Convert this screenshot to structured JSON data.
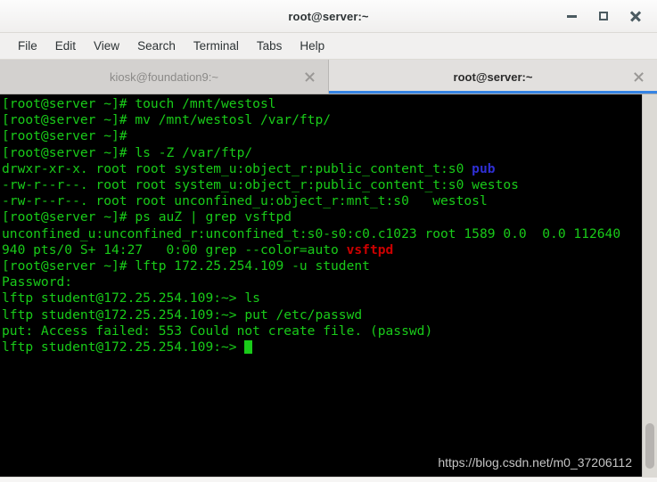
{
  "window": {
    "title": "root@server:~",
    "controls": {
      "minimize": "minimize",
      "maximize": "maximize",
      "close": "close"
    }
  },
  "menubar": {
    "items": [
      {
        "label": "File"
      },
      {
        "label": "Edit"
      },
      {
        "label": "View"
      },
      {
        "label": "Search"
      },
      {
        "label": "Terminal"
      },
      {
        "label": "Tabs"
      },
      {
        "label": "Help"
      }
    ]
  },
  "tabs": [
    {
      "label": "kiosk@foundation9:~",
      "active": false
    },
    {
      "label": "root@server:~",
      "active": true
    }
  ],
  "terminal": {
    "lines": [
      {
        "segments": [
          {
            "text": "[root@server ~]# touch /mnt/westosl",
            "style": "g"
          }
        ]
      },
      {
        "segments": [
          {
            "text": "[root@server ~]# mv /mnt/westosl /var/ftp/",
            "style": "g"
          }
        ]
      },
      {
        "segments": [
          {
            "text": "[root@server ~]#",
            "style": "g"
          }
        ]
      },
      {
        "segments": [
          {
            "text": "[root@server ~]# ls -Z /var/ftp/",
            "style": "g"
          }
        ]
      },
      {
        "segments": [
          {
            "text": "drwxr-xr-x. root root system_u:object_r:public_content_t:s0 ",
            "style": "g"
          },
          {
            "text": "pub",
            "style": "blue-b"
          }
        ]
      },
      {
        "segments": [
          {
            "text": "-rw-r--r--. root root system_u:object_r:public_content_t:s0 westos",
            "style": "g"
          }
        ]
      },
      {
        "segments": [
          {
            "text": "-rw-r--r--. root root unconfined_u:object_r:mnt_t:s0   westosl",
            "style": "g"
          }
        ]
      },
      {
        "segments": [
          {
            "text": "[root@server ~]# ps auZ | grep vsftpd",
            "style": "g"
          }
        ]
      },
      {
        "segments": [
          {
            "text": "unconfined_u:unconfined_r:unconfined_t:s0-s0:c0.c1023 root 1589 0.0  0.0 112640",
            "style": "g"
          }
        ]
      },
      {
        "segments": [
          {
            "text": "940 pts/0 S+ 14:27   0:00 grep --color=auto ",
            "style": "g"
          },
          {
            "text": "vsftpd",
            "style": "red-b"
          }
        ]
      },
      {
        "segments": [
          {
            "text": "[root@server ~]# lftp 172.25.254.109 -u student",
            "style": "g"
          }
        ]
      },
      {
        "segments": [
          {
            "text": "Password:",
            "style": "g"
          }
        ]
      },
      {
        "segments": [
          {
            "text": "lftp student@172.25.254.109:~> ls",
            "style": "g"
          }
        ]
      },
      {
        "segments": [
          {
            "text": "lftp student@172.25.254.109:~> put /etc/passwd",
            "style": "g"
          }
        ]
      },
      {
        "segments": [
          {
            "text": "put: Access failed: 553 Could not create file. (passwd)",
            "style": "g"
          }
        ]
      },
      {
        "segments": [
          {
            "text": "lftp student@172.25.254.109:~> ",
            "style": "g"
          }
        ],
        "cursor": true
      }
    ],
    "watermark": "https://blog.csdn.net/m0_37206112"
  },
  "scrollbar": {
    "thumb_top_pct": 86,
    "thumb_height_pct": 12
  }
}
